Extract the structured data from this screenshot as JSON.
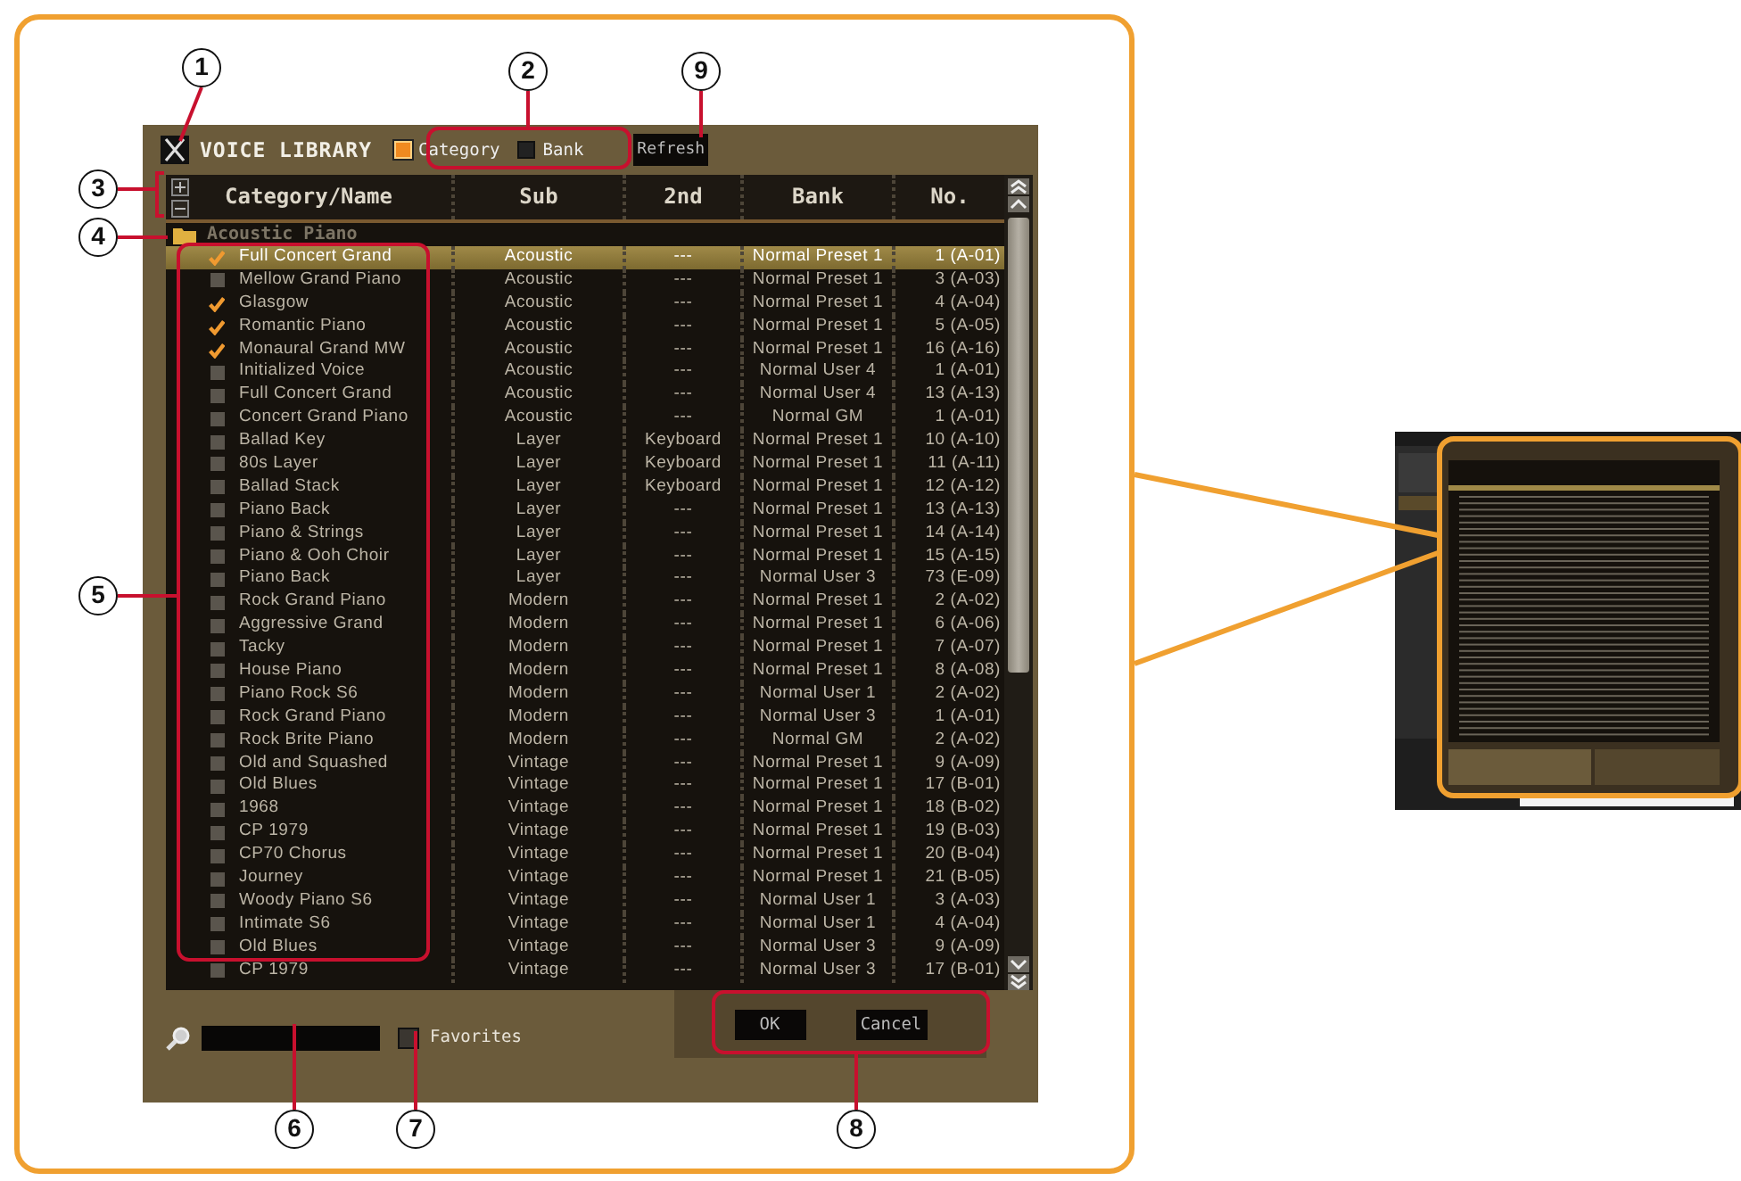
{
  "callouts": [
    {
      "label": "1"
    },
    {
      "label": "2"
    },
    {
      "label": "9"
    },
    {
      "label": "3"
    },
    {
      "label": "4"
    },
    {
      "label": "5"
    },
    {
      "label": "6"
    },
    {
      "label": "7"
    },
    {
      "label": "8"
    }
  ],
  "window": {
    "title": "VOICE LIBRARY"
  },
  "sort_options": [
    {
      "label": "Category",
      "selected": true
    },
    {
      "label": "Bank",
      "selected": false
    }
  ],
  "refresh_button": "Refresh",
  "table": {
    "columns": [
      "Category/Name",
      "Sub",
      "2nd",
      "Bank",
      "No."
    ],
    "group": "Acoustic Piano",
    "rows": [
      {
        "name": "Full Concert Grand",
        "sub": "Acoustic",
        "second": "---",
        "bank": "Normal Preset 1",
        "number": "1 (A-01)",
        "favorite": true,
        "selected": true
      },
      {
        "name": "Mellow Grand Piano",
        "sub": "Acoustic",
        "second": "---",
        "bank": "Normal Preset 1",
        "number": "3 (A-03)",
        "favorite": false,
        "selected": false
      },
      {
        "name": "Glasgow",
        "sub": "Acoustic",
        "second": "---",
        "bank": "Normal Preset 1",
        "number": "4 (A-04)",
        "favorite": true,
        "selected": false
      },
      {
        "name": "Romantic Piano",
        "sub": "Acoustic",
        "second": "---",
        "bank": "Normal Preset 1",
        "number": "5 (A-05)",
        "favorite": true,
        "selected": false
      },
      {
        "name": "Monaural Grand MW",
        "sub": "Acoustic",
        "second": "---",
        "bank": "Normal Preset 1",
        "number": "16 (A-16)",
        "favorite": true,
        "selected": false
      },
      {
        "name": "Initialized Voice",
        "sub": "Acoustic",
        "second": "---",
        "bank": "Normal User 4",
        "number": "1 (A-01)",
        "favorite": false,
        "selected": false
      },
      {
        "name": "Full Concert Grand",
        "sub": "Acoustic",
        "second": "---",
        "bank": "Normal User 4",
        "number": "13 (A-13)",
        "favorite": false,
        "selected": false
      },
      {
        "name": "Concert Grand Piano",
        "sub": "Acoustic",
        "second": "---",
        "bank": "Normal GM",
        "number": "1 (A-01)",
        "favorite": false,
        "selected": false
      },
      {
        "name": "Ballad Key",
        "sub": "Layer",
        "second": "Keyboard",
        "bank": "Normal Preset 1",
        "number": "10 (A-10)",
        "favorite": false,
        "selected": false
      },
      {
        "name": "80s Layer",
        "sub": "Layer",
        "second": "Keyboard",
        "bank": "Normal Preset 1",
        "number": "11 (A-11)",
        "favorite": false,
        "selected": false
      },
      {
        "name": "Ballad Stack",
        "sub": "Layer",
        "second": "Keyboard",
        "bank": "Normal Preset 1",
        "number": "12 (A-12)",
        "favorite": false,
        "selected": false
      },
      {
        "name": "Piano Back",
        "sub": "Layer",
        "second": "---",
        "bank": "Normal Preset 1",
        "number": "13 (A-13)",
        "favorite": false,
        "selected": false
      },
      {
        "name": "Piano & Strings",
        "sub": "Layer",
        "second": "---",
        "bank": "Normal Preset 1",
        "number": "14 (A-14)",
        "favorite": false,
        "selected": false
      },
      {
        "name": "Piano & Ooh Choir",
        "sub": "Layer",
        "second": "---",
        "bank": "Normal Preset 1",
        "number": "15 (A-15)",
        "favorite": false,
        "selected": false
      },
      {
        "name": "Piano Back",
        "sub": "Layer",
        "second": "---",
        "bank": "Normal User 3",
        "number": "73 (E-09)",
        "favorite": false,
        "selected": false
      },
      {
        "name": "Rock Grand Piano",
        "sub": "Modern",
        "second": "---",
        "bank": "Normal Preset 1",
        "number": "2 (A-02)",
        "favorite": false,
        "selected": false
      },
      {
        "name": "Aggressive Grand",
        "sub": "Modern",
        "second": "---",
        "bank": "Normal Preset 1",
        "number": "6 (A-06)",
        "favorite": false,
        "selected": false
      },
      {
        "name": "Tacky",
        "sub": "Modern",
        "second": "---",
        "bank": "Normal Preset 1",
        "number": "7 (A-07)",
        "favorite": false,
        "selected": false
      },
      {
        "name": "House Piano",
        "sub": "Modern",
        "second": "---",
        "bank": "Normal Preset 1",
        "number": "8 (A-08)",
        "favorite": false,
        "selected": false
      },
      {
        "name": "Piano Rock S6",
        "sub": "Modern",
        "second": "---",
        "bank": "Normal User 1",
        "number": "2 (A-02)",
        "favorite": false,
        "selected": false
      },
      {
        "name": "Rock Grand Piano",
        "sub": "Modern",
        "second": "---",
        "bank": "Normal User 3",
        "number": "1 (A-01)",
        "favorite": false,
        "selected": false
      },
      {
        "name": "Rock Brite Piano",
        "sub": "Modern",
        "second": "---",
        "bank": "Normal GM",
        "number": "2 (A-02)",
        "favorite": false,
        "selected": false
      },
      {
        "name": "Old and Squashed",
        "sub": "Vintage",
        "second": "---",
        "bank": "Normal Preset 1",
        "number": "9 (A-09)",
        "favorite": false,
        "selected": false
      },
      {
        "name": "Old Blues",
        "sub": "Vintage",
        "second": "---",
        "bank": "Normal Preset 1",
        "number": "17 (B-01)",
        "favorite": false,
        "selected": false
      },
      {
        "name": "1968",
        "sub": "Vintage",
        "second": "---",
        "bank": "Normal Preset 1",
        "number": "18 (B-02)",
        "favorite": false,
        "selected": false
      },
      {
        "name": "CP 1979",
        "sub": "Vintage",
        "second": "---",
        "bank": "Normal Preset 1",
        "number": "19 (B-03)",
        "favorite": false,
        "selected": false
      },
      {
        "name": "CP70 Chorus",
        "sub": "Vintage",
        "second": "---",
        "bank": "Normal Preset 1",
        "number": "20 (B-04)",
        "favorite": false,
        "selected": false
      },
      {
        "name": "Journey",
        "sub": "Vintage",
        "second": "---",
        "bank": "Normal Preset 1",
        "number": "21 (B-05)",
        "favorite": false,
        "selected": false
      },
      {
        "name": "Woody Piano S6",
        "sub": "Vintage",
        "second": "---",
        "bank": "Normal User 1",
        "number": "3 (A-03)",
        "favorite": false,
        "selected": false
      },
      {
        "name": "Intimate S6",
        "sub": "Vintage",
        "second": "---",
        "bank": "Normal User 1",
        "number": "4 (A-04)",
        "favorite": false,
        "selected": false
      },
      {
        "name": "Old Blues",
        "sub": "Vintage",
        "second": "---",
        "bank": "Normal User 3",
        "number": "9 (A-09)",
        "favorite": false,
        "selected": false
      },
      {
        "name": "CP 1979",
        "sub": "Vintage",
        "second": "---",
        "bank": "Normal User 3",
        "number": "17 (B-01)",
        "favorite": false,
        "selected": false
      }
    ]
  },
  "favorites_filter": {
    "label": "Favorites",
    "checked": false
  },
  "buttons": [
    "OK",
    "Cancel"
  ]
}
